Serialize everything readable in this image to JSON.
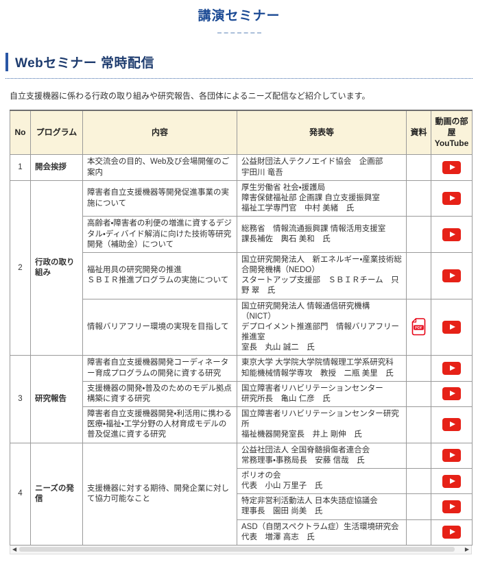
{
  "page": {
    "title": "講演セミナー",
    "section_title": "Webセミナー 常時配信",
    "description": "自立支援機器に係わる行政の取り組みや研究報告、各団体によるニーズ配信など紹介しています。"
  },
  "colors": {
    "accent_blue": "#1b4a94",
    "section_blue": "#1d3b6e",
    "header_bg": "#faf3da",
    "youtube_red": "#e62117",
    "pdf_red": "#e60012"
  },
  "table": {
    "headers": {
      "no": "No",
      "program": "プログラム",
      "content": "内容",
      "presenter": "発表等",
      "material": "資料",
      "video": "動画の部屋\nYouTube"
    },
    "pdf_label": "PDF",
    "groups": [
      {
        "no": "1",
        "program": "開会挨拶",
        "items": [
          {
            "content": "本交流会の目的、Web及び会場開催のご案内",
            "presenter": "公益財団法人テクノエイド協会　企画部\n宇田川 竜吾",
            "pdf": false,
            "youtube": true
          }
        ]
      },
      {
        "no": "2",
        "program": "行政の取り組み",
        "items": [
          {
            "content": "障害者自立支援機器等開発促進事業の実施について",
            "presenter": "厚生労働省 社会・援護局\n障害保健福祉部 企画課 自立支援振興室\n福祉工学専門官　中村 美緒　氏",
            "pdf": false,
            "youtube": true
          },
          {
            "content": "高齢者・障害者の利便の増進に資するデジタル・ディバイド解消に向けた技術等研究開発（補助金）について",
            "presenter": "総務省　情報流通振興課 情報活用支援室\n課長補佐　輿石 美和　氏",
            "pdf": false,
            "youtube": true
          },
          {
            "content": "福祉用具の研究開発の推進\nＳＢＩＲ推進プログラムの実施について",
            "presenter": "国立研究開発法人　新エネルギー・産業技術総合開発機構（NEDO）\nスタートアップ支援部　ＳＢＩＲチーム　只野 翠　氏",
            "pdf": false,
            "youtube": true
          },
          {
            "content": "情報バリアフリー環境の実現を目指して",
            "presenter": "国立研究開発法人 情報通信研究機構（NICT）\nデプロイメント推進部門　情報バリアフリー推進室\n室長　丸山 誠二　氏",
            "pdf": true,
            "youtube": true
          }
        ]
      },
      {
        "no": "3",
        "program": "研究報告",
        "items": [
          {
            "content": "障害者自立支援機器開発コーディネーター育成プログラムの開発に資する研究",
            "presenter": "東京大学 大学院大学院情報理工学系研究科\n知能機械情報学専攻　教授　二瓶 美里　氏",
            "pdf": false,
            "youtube": true
          },
          {
            "content": "支援機器の開発・普及のためのモデル拠点構築に資する研究",
            "presenter": "国立障害者リハビリテーションセンター\n研究所長　亀山 仁彦　氏",
            "pdf": false,
            "youtube": true
          },
          {
            "content": "障害者自立支援機器開発・利活用に携わる医療・福祉・工学分野の人材育成モデルの普及促進に資する研究",
            "presenter": "国立障害者リハビリテーションセンター研究所\n福祉機器開発室長　井上 剛伸　氏",
            "pdf": false,
            "youtube": true
          }
        ]
      },
      {
        "no": "4",
        "program": "ニーズの発信",
        "shared_content": "支援機器に対する期待、開発企業に対して協力可能なこと",
        "items": [
          {
            "presenter": "公益社団法人 全国脊髄損傷者連合会\n常務理事・事務局長　安藤 信哉　氏",
            "pdf": false,
            "youtube": true
          },
          {
            "presenter": "ポリオの会\n代表　小山 万里子　氏",
            "pdf": false,
            "youtube": true
          },
          {
            "presenter": "特定非営利活動法人 日本失語症協議会\n理事長　園田 尚美　氏",
            "pdf": false,
            "youtube": true
          },
          {
            "presenter": "ASD（自閉スペクトラム症）生活環境研究会\n代表　増澤 高志　氏",
            "pdf": false,
            "youtube": true
          }
        ]
      }
    ]
  },
  "scrollbar": {
    "left_arrow": "◀",
    "right_arrow": "▶"
  }
}
